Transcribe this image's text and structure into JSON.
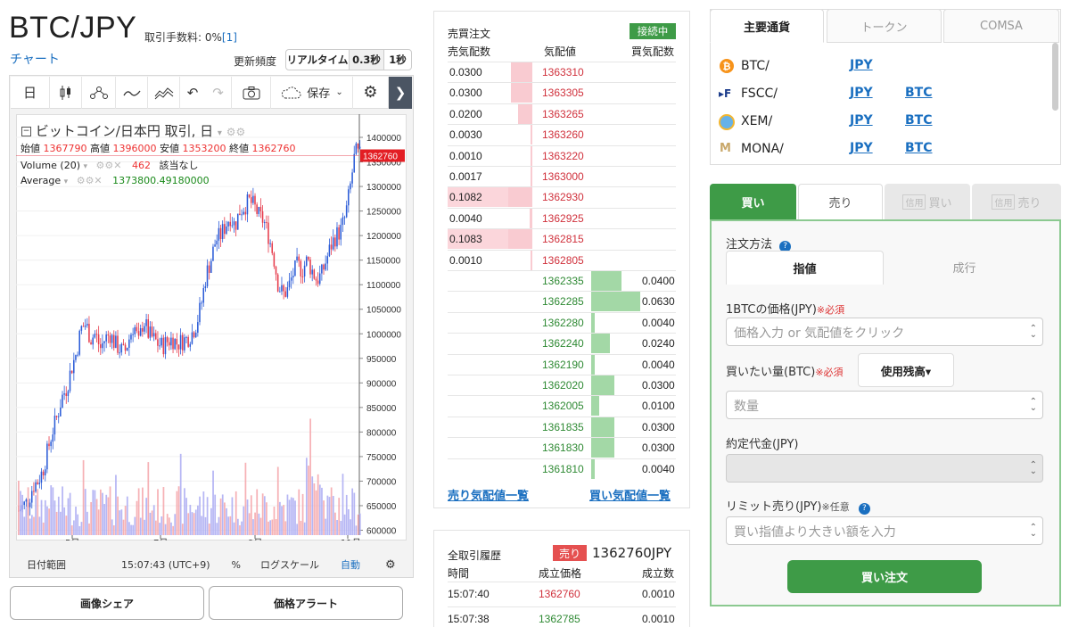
{
  "header": {
    "pair": "BTC/JPY",
    "fee_label": "取引手数料: 0%",
    "fee_link": "[1]",
    "chart_link": "チャート",
    "refresh_label": "更新頻度",
    "refresh_options": [
      "リアルタイム",
      "0.3秒",
      "1秒"
    ]
  },
  "chart": {
    "toolbar": {
      "day": "日",
      "save": "保存"
    },
    "title": "ビットコイン/日本円 取引, 日",
    "ohlc": {
      "open_label": "始値",
      "open": "1367790",
      "high_label": "高値",
      "high": "1396000",
      "low_label": "安値",
      "low": "1353200",
      "close_label": "終値",
      "close": "1362760"
    },
    "volume_label": "Volume (20)",
    "volume_value": "462",
    "volume_na": "該当なし",
    "average_label": "Average",
    "average_value": "1373800.49180000",
    "price_tag": "1362760",
    "y_ticks": [
      "1400000",
      "1350000",
      "1300000",
      "1250000",
      "1200000",
      "1150000",
      "1100000",
      "1050000",
      "1000000",
      "950000",
      "900000",
      "850000",
      "800000",
      "750000",
      "700000",
      "650000",
      "600000"
    ],
    "x_ticks": [
      "5月",
      "7月",
      "9月",
      "11月"
    ],
    "footer": {
      "range": "日付範囲",
      "time": "15:07:43 (UTC+9)",
      "pct": "%",
      "log": "ログスケール",
      "auto": "自動"
    }
  },
  "chart_data": {
    "type": "candlestick",
    "title": "ビットコイン/日本円 取引, 日",
    "ylim": [
      590000,
      1420000
    ],
    "x_ticks": [
      "5月",
      "7月",
      "9月",
      "11月"
    ],
    "close_series": [
      640000,
      650000,
      660000,
      690000,
      700000,
      720000,
      760000,
      800000,
      830000,
      870000,
      890000,
      930000,
      960000,
      1010000,
      1020000,
      990000,
      1000000,
      970000,
      990000,
      1000000,
      980000,
      970000,
      960000,
      990000,
      1020000,
      980000,
      1030000,
      1000000,
      990000,
      980000,
      975000,
      985000,
      990000,
      980000,
      985000,
      990000,
      1000000,
      1020000,
      1060000,
      1120000,
      1150000,
      1190000,
      1200000,
      1220000,
      1240000,
      1220000,
      1250000,
      1260000,
      1270000,
      1260000,
      1240000,
      1230000,
      1200000,
      1160000,
      1100000,
      1080000,
      1090000,
      1120000,
      1140000,
      1130000,
      1150000,
      1130000,
      1110000,
      1120000,
      1150000,
      1180000,
      1200000,
      1210000,
      1240000,
      1300000,
      1370000,
      1362760
    ],
    "current_price": 1362760
  },
  "orderbook": {
    "title": "売買注文",
    "status": "接続中",
    "col_ask": "売気配数",
    "col_price": "気配値",
    "col_bid": "買気配数",
    "asks": [
      {
        "qty": "0.0300",
        "price": "1363310",
        "bar": 0.9
      },
      {
        "qty": "0.0300",
        "price": "1363305",
        "bar": 0.9
      },
      {
        "qty": "0.0200",
        "price": "1363265",
        "bar": 0.6
      },
      {
        "qty": "0.0030",
        "price": "1363260",
        "bar": 0.09
      },
      {
        "qty": "0.0010",
        "price": "1363220",
        "bar": 0.03
      },
      {
        "qty": "0.0017",
        "price": "1363000",
        "bar": 0.05
      },
      {
        "qty": "0.1082",
        "price": "1362930",
        "bar": 1.0
      },
      {
        "qty": "0.0040",
        "price": "1362925",
        "bar": 0.12
      },
      {
        "qty": "0.1083",
        "price": "1362815",
        "bar": 1.0
      },
      {
        "qty": "0.0010",
        "price": "1362805",
        "bar": 0.03
      }
    ],
    "bids": [
      {
        "qty": "0.0400",
        "price": "1362335",
        "bar": 0.62
      },
      {
        "qty": "0.0630",
        "price": "1362285",
        "bar": 1.0
      },
      {
        "qty": "0.0040",
        "price": "1362280",
        "bar": 0.07
      },
      {
        "qty": "0.0240",
        "price": "1362240",
        "bar": 0.38
      },
      {
        "qty": "0.0040",
        "price": "1362190",
        "bar": 0.07
      },
      {
        "qty": "0.0300",
        "price": "1362020",
        "bar": 0.48
      },
      {
        "qty": "0.0100",
        "price": "1362005",
        "bar": 0.16
      },
      {
        "qty": "0.0300",
        "price": "1361835",
        "bar": 0.48
      },
      {
        "qty": "0.0300",
        "price": "1361830",
        "bar": 0.48
      },
      {
        "qty": "0.0040",
        "price": "1361810",
        "bar": 0.07
      }
    ],
    "ask_list_link": "売り気配値一覧",
    "bid_list_link": "買い気配値一覧"
  },
  "history": {
    "title": "全取引履歴",
    "side": "売り",
    "last": "1362760JPY",
    "col_time": "時間",
    "col_price": "成立価格",
    "col_qty": "成立数",
    "rows": [
      {
        "time": "15:07:40",
        "price": "1362760",
        "qty": "0.0010",
        "side": "sell"
      },
      {
        "time": "15:07:38",
        "price": "1362785",
        "qty": "0.0010",
        "side": "buy"
      }
    ]
  },
  "currencies": {
    "tabs": [
      "主要通貨",
      "トークン",
      "COMSA"
    ],
    "items": [
      {
        "name": "BTC/",
        "links": [
          "JPY"
        ],
        "icon": "bitcoin-icon",
        "color": "#f7931a"
      },
      {
        "name": "FSCC/",
        "links": [
          "JPY",
          "BTC"
        ],
        "icon": "fscc-icon",
        "color": "#1a3a8a"
      },
      {
        "name": "XEM/",
        "links": [
          "JPY",
          "BTC"
        ],
        "icon": "xem-icon",
        "color": "#67b2e8"
      },
      {
        "name": "MONA/",
        "links": [
          "JPY",
          "BTC"
        ],
        "icon": "mona-icon",
        "color": "#c9a86a"
      }
    ]
  },
  "order": {
    "tabs": {
      "buy": "買い",
      "sell": "売り",
      "margin_badge": "信用",
      "margin_buy": "買い",
      "margin_sell": "売り"
    },
    "method_label": "注文方法",
    "method_limit": "指値",
    "method_market": "成行",
    "price_label": "1BTCの価格(JPY)",
    "required": "※必須",
    "price_placeholder": "価格入力 or 気配値をクリック",
    "qty_label": "買いたい量(BTC)",
    "use_balance": "使用残高▾",
    "qty_placeholder": "数量",
    "amount_label": "約定代金(JPY)",
    "limit_label": "リミット売り(JPY)",
    "optional": "※任意",
    "limit_placeholder": "買い指値より大きい額を入力",
    "submit": "買い注文"
  }
}
